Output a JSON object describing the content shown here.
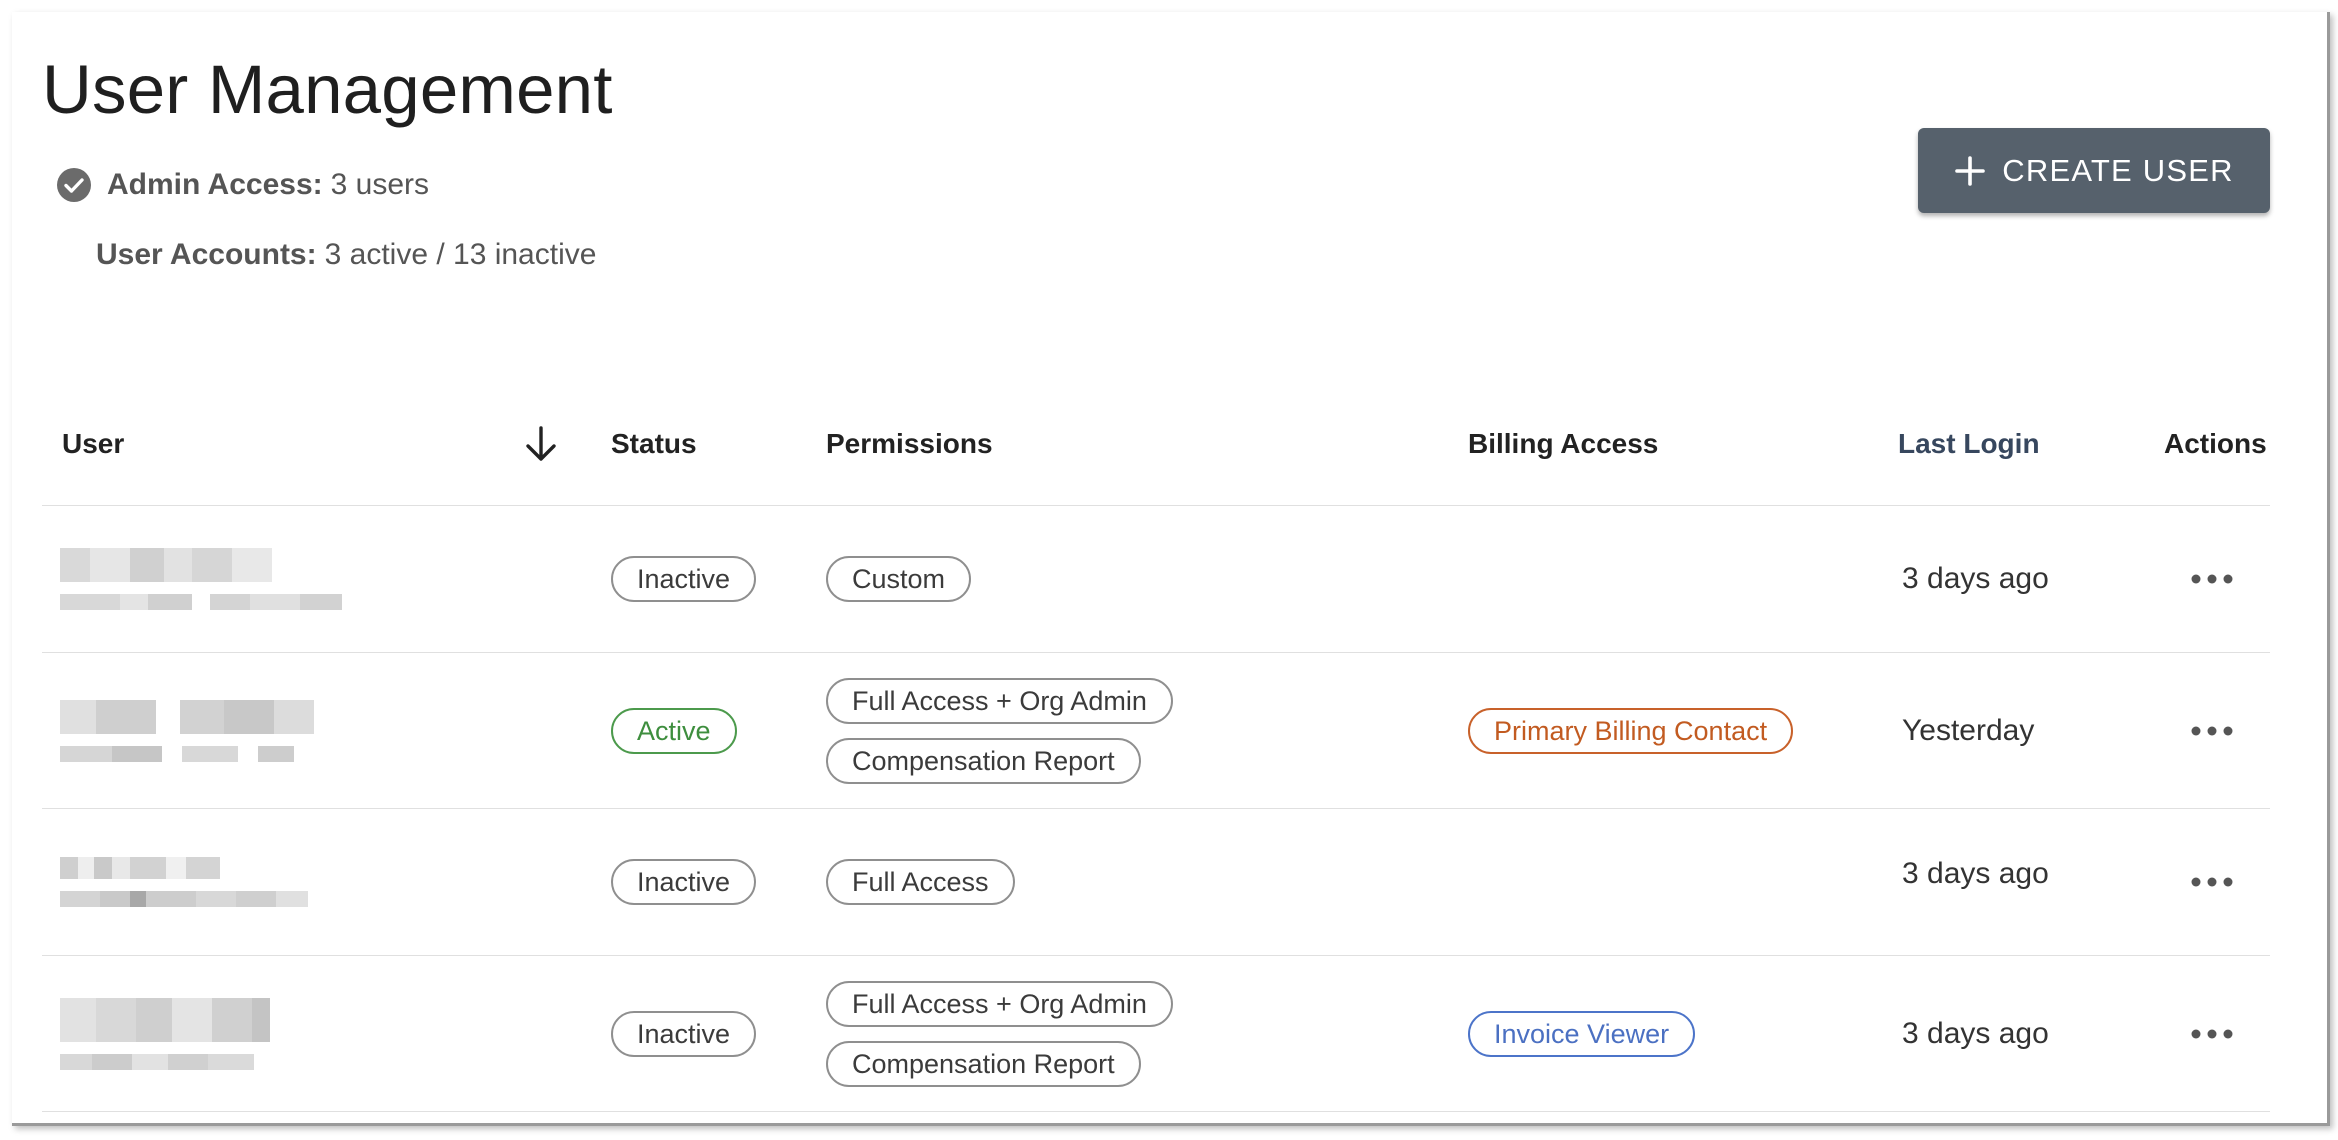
{
  "page": {
    "title": "User Management",
    "admin_access_label": "Admin Access:",
    "admin_access_value": "3 users",
    "user_accounts_label": "User Accounts:",
    "user_accounts_value": "3 active / 13 inactive",
    "create_button_label": "CREATE USER"
  },
  "table": {
    "columns": {
      "user": "User",
      "status": "Status",
      "permissions": "Permissions",
      "billing": "Billing Access",
      "last_login": "Last Login",
      "actions": "Actions"
    },
    "sort_icon": "arrow-down-icon",
    "rows": [
      {
        "status": "Inactive",
        "permissions": [
          "Custom"
        ],
        "billing": "",
        "last_login": "3 days ago"
      },
      {
        "status": "Active",
        "permissions": [
          "Full Access + Org Admin",
          "Compensation Report"
        ],
        "billing": "Primary Billing Contact",
        "last_login": "Yesterday"
      },
      {
        "status": "Inactive",
        "permissions": [
          "Full Access"
        ],
        "billing": "",
        "last_login": "3 days ago"
      },
      {
        "status": "Inactive",
        "permissions": [
          "Full Access + Org Admin",
          "Compensation Report"
        ],
        "billing": "Invoice Viewer",
        "last_login": "3 days ago"
      }
    ]
  },
  "colors": {
    "button_bg": "#56616c",
    "active_green": "#3e8e3e",
    "billing_orange": "#c25b21",
    "billing_blue": "#4b70c2"
  }
}
